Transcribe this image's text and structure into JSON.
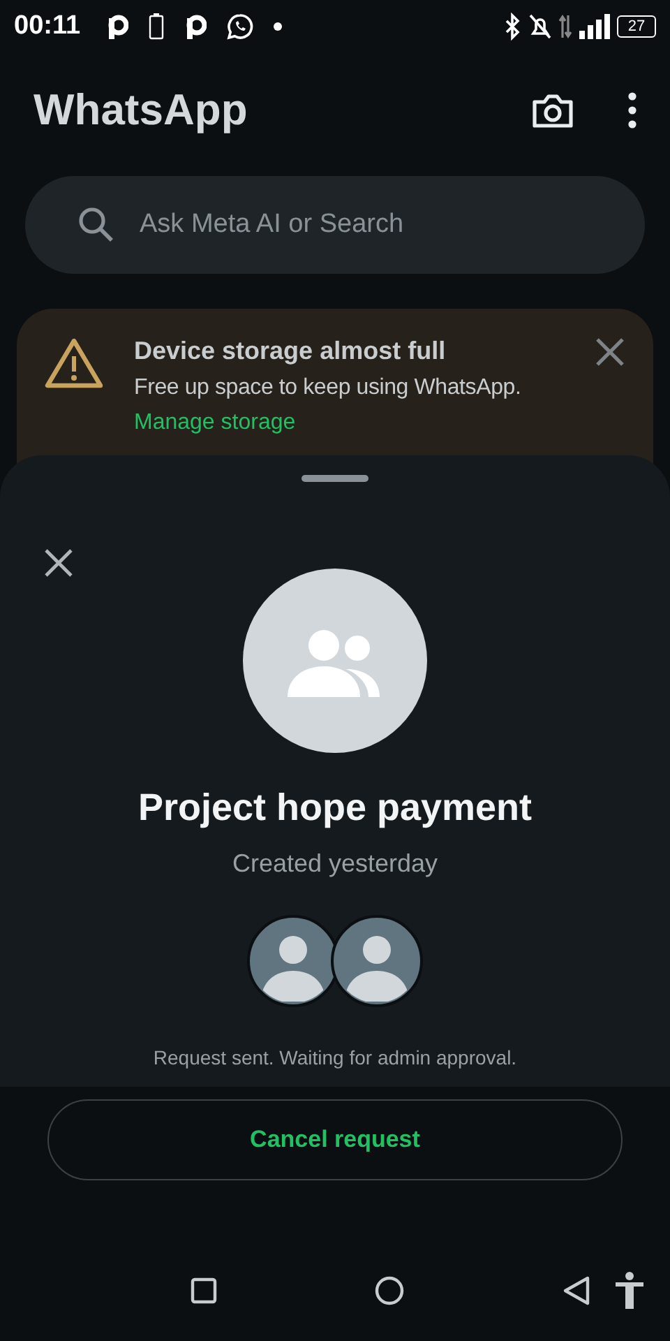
{
  "status_bar": {
    "time": "00:11",
    "battery": "27"
  },
  "header": {
    "title": "WhatsApp"
  },
  "search": {
    "placeholder": "Ask Meta AI or Search"
  },
  "banner": {
    "title": "Device storage almost full",
    "message": "Free up space to keep using WhatsApp.",
    "link": "Manage storage"
  },
  "sheet": {
    "group_name": "Project hope payment",
    "subtitle": "Created yesterday",
    "members": [
      {
        "kind": "avatar"
      },
      {
        "kind": "avatar"
      }
    ],
    "status": "Request sent. Waiting for admin approval.",
    "cancel_button": "Cancel request"
  }
}
